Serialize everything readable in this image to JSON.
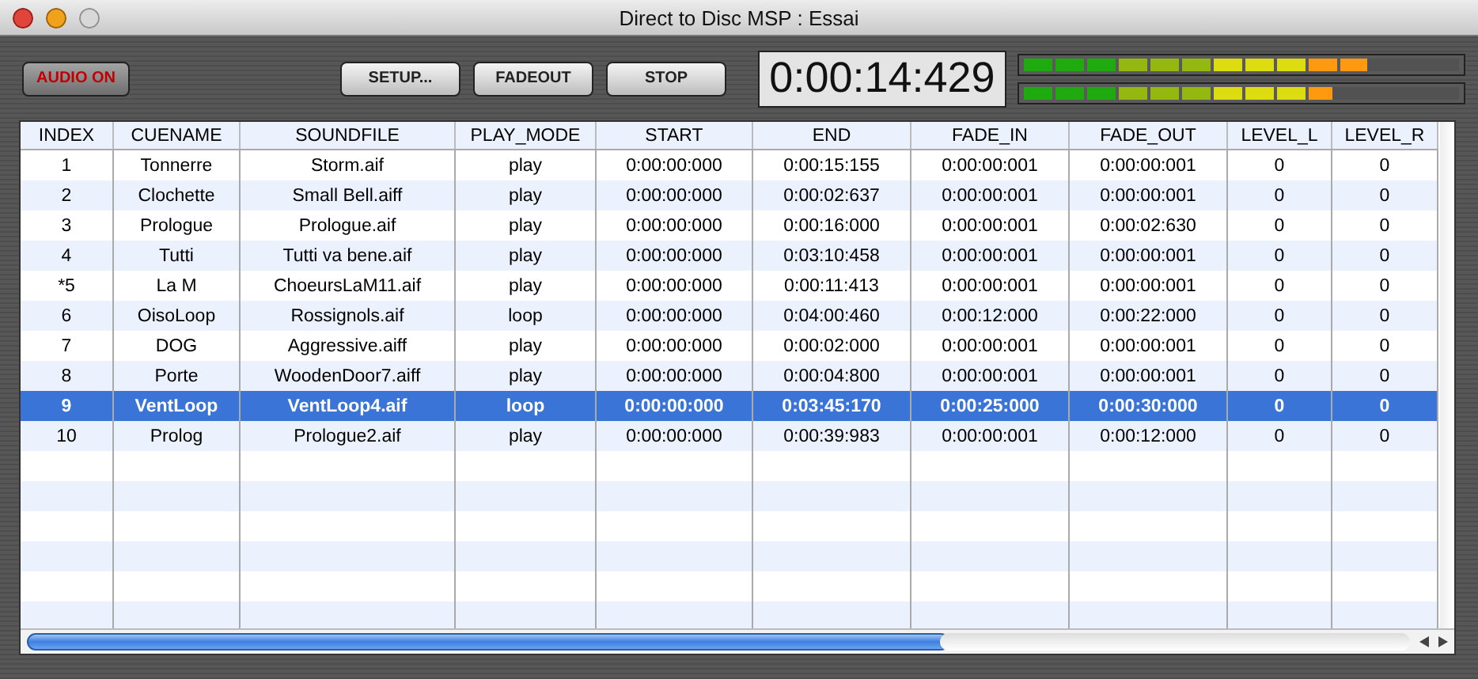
{
  "window": {
    "title": "Direct to Disc MSP : Essai"
  },
  "toolbar": {
    "audio_button": {
      "label": "AUDIO ON",
      "active": true
    },
    "buttons": [
      "SETUP...",
      "FADEOUT",
      "STOP"
    ],
    "timer": "0:00:14:429",
    "meters": [
      {
        "level": 0.79
      },
      {
        "level": 0.71
      }
    ]
  },
  "table": {
    "columns": [
      "INDEX",
      "CUENAME",
      "SOUNDFILE",
      "PLAY_MODE",
      "START",
      "END",
      "FADE_IN",
      "FADE_OUT",
      "LEVEL_L",
      "LEVEL_R"
    ],
    "rows": [
      {
        "selected": false,
        "cells": [
          "1",
          "Tonnerre",
          "Storm.aif",
          "play",
          "0:00:00:000",
          "0:00:15:155",
          "0:00:00:001",
          "0:00:00:001",
          "0",
          "0"
        ]
      },
      {
        "selected": false,
        "cells": [
          "2",
          "Clochette",
          "Small Bell.aiff",
          "play",
          "0:00:00:000",
          "0:00:02:637",
          "0:00:00:001",
          "0:00:00:001",
          "0",
          "0"
        ]
      },
      {
        "selected": false,
        "cells": [
          "3",
          "Prologue",
          "Prologue.aif",
          "play",
          "0:00:00:000",
          "0:00:16:000",
          "0:00:00:001",
          "0:00:02:630",
          "0",
          "0"
        ]
      },
      {
        "selected": false,
        "cells": [
          "4",
          "Tutti",
          "Tutti va bene.aif",
          "play",
          "0:00:00:000",
          "0:03:10:458",
          "0:00:00:001",
          "0:00:00:001",
          "0",
          "0"
        ]
      },
      {
        "selected": false,
        "cells": [
          "*5",
          "La M",
          "ChoeursLaM11.aif",
          "play",
          "0:00:00:000",
          "0:00:11:413",
          "0:00:00:001",
          "0:00:00:001",
          "0",
          "0"
        ]
      },
      {
        "selected": false,
        "cells": [
          "6",
          "OisoLoop",
          "Rossignols.aif",
          "loop",
          "0:00:00:000",
          "0:04:00:460",
          "0:00:12:000",
          "0:00:22:000",
          "0",
          "0"
        ]
      },
      {
        "selected": false,
        "cells": [
          "7",
          "DOG",
          "Aggressive.aiff",
          "play",
          "0:00:00:000",
          "0:00:02:000",
          "0:00:00:001",
          "0:00:00:001",
          "0",
          "0"
        ]
      },
      {
        "selected": false,
        "cells": [
          "8",
          "Porte",
          "WoodenDoor7.aiff",
          "play",
          "0:00:00:000",
          "0:00:04:800",
          "0:00:00:001",
          "0:00:00:001",
          "0",
          "0"
        ]
      },
      {
        "selected": true,
        "cells": [
          "9",
          "VentLoop",
          "VentLoop4.aif",
          "loop",
          "0:00:00:000",
          "0:03:45:170",
          "0:00:25:000",
          "0:00:30:000",
          "0",
          "0"
        ]
      },
      {
        "selected": false,
        "cells": [
          "10",
          "Prolog",
          "Prologue2.aif",
          "play",
          "0:00:00:000",
          "0:00:39:983",
          "0:00:00:001",
          "0:00:12:000",
          "0",
          "0"
        ]
      }
    ]
  }
}
